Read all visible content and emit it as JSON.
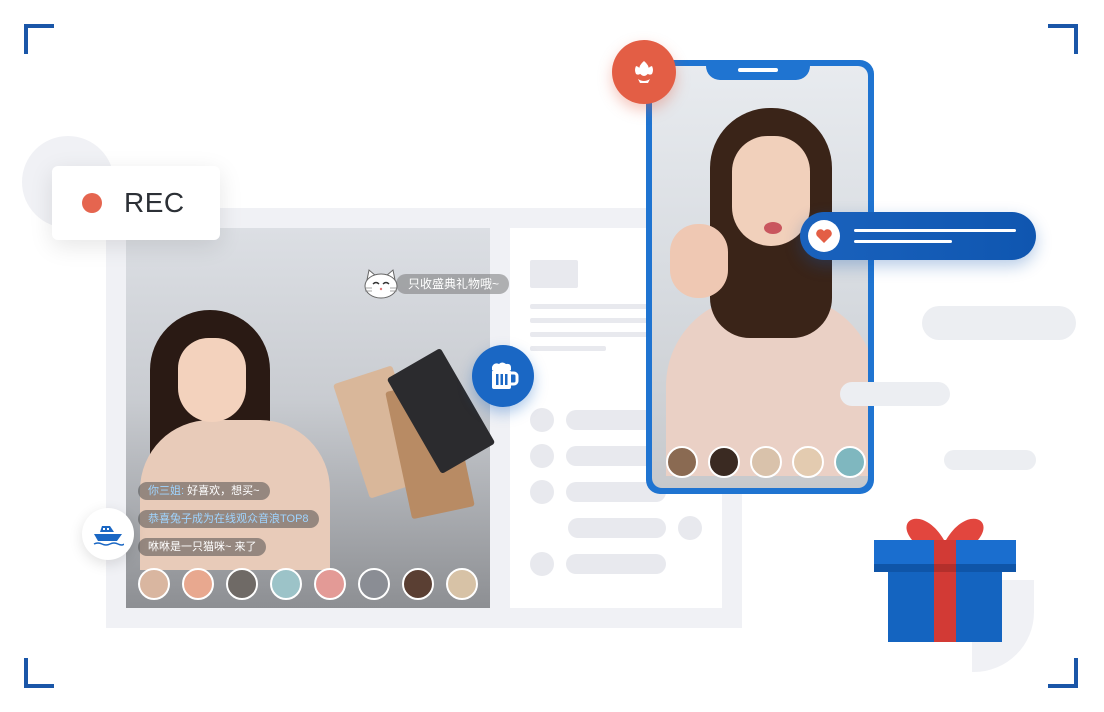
{
  "rec_indicator": {
    "label": "REC",
    "dot_color": "#e5654f"
  },
  "live_stream": {
    "gift_message": "只收盛典礼物哦~",
    "chat_messages": [
      {
        "user": "你三姐:",
        "text": "好喜欢，想买~"
      },
      {
        "user": "",
        "text": "恭喜兔子成为在线观众音浪TOP8"
      },
      {
        "user": "",
        "text": "咻咻是一只猫咪~ 来了"
      }
    ],
    "viewer_count_shown": 8
  },
  "phone_stream": {
    "viewer_count_shown": 5
  },
  "icons": {
    "beer": "beer-mug-icon",
    "ship": "yacht-icon",
    "flower": "flower-icon",
    "heart": "heart-icon",
    "gift": "gift-box-icon",
    "cat": "cat-face-icon"
  },
  "colors": {
    "brand_blue": "#1a67c4",
    "accent_red": "#e35e45"
  }
}
